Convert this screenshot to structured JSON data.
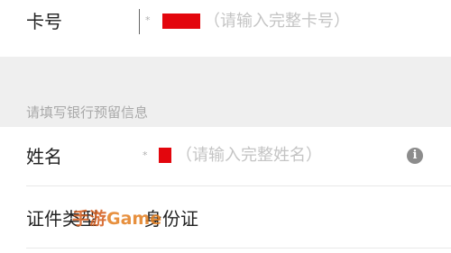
{
  "card": {
    "label": "卡号",
    "masked_prefix": "*",
    "placeholder": "（请输入完整卡号）"
  },
  "section": {
    "title": "请填写银行预留信息"
  },
  "name": {
    "label": "姓名",
    "masked_prefix": "*",
    "placeholder": "（请输入完整姓名）",
    "info_icon": "i"
  },
  "id_type": {
    "label": "证件类型",
    "value": "身份证"
  },
  "watermark": {
    "cn": "手游",
    "en": "Game"
  },
  "colors": {
    "redaction": "#e3060d",
    "section_bg": "#efefef"
  }
}
